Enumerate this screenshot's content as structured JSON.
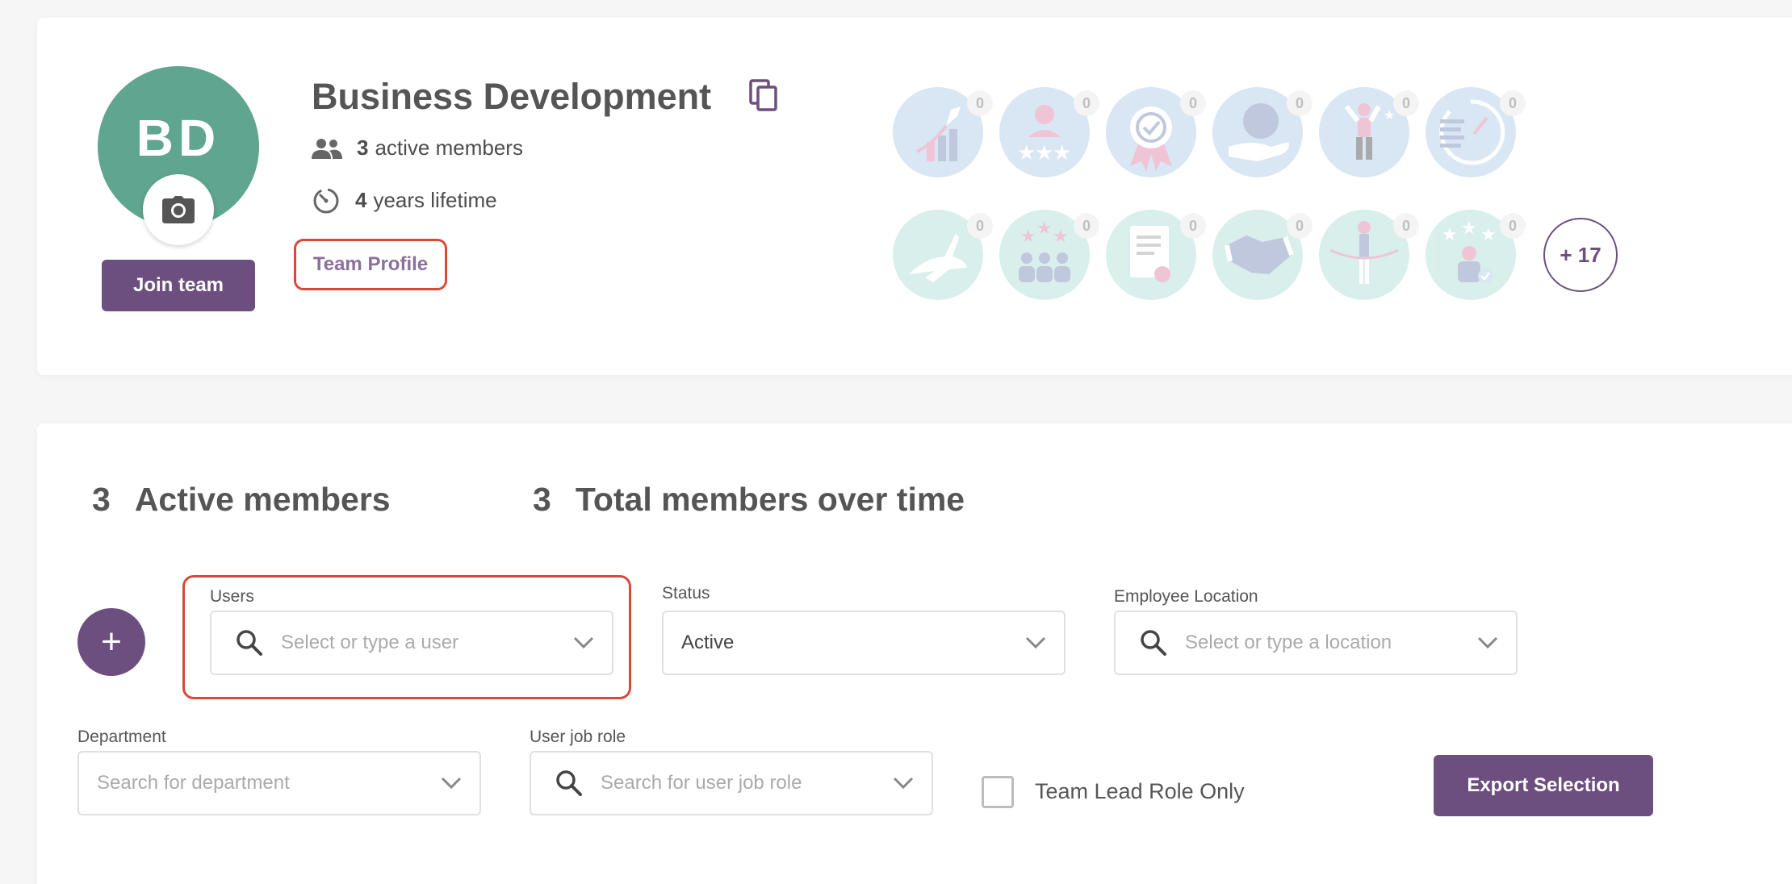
{
  "team": {
    "initials": "BD",
    "name": "Business Development",
    "active_members_count": "3",
    "active_members_text": "active members",
    "lifetime_count": "4",
    "lifetime_text": "years lifetime",
    "team_profile_link": "Team Profile",
    "join_button": "Join team"
  },
  "badges": {
    "row1": [
      {
        "icon": "rocket-growth-icon",
        "count": "0"
      },
      {
        "icon": "star-rating-person-icon",
        "count": "0"
      },
      {
        "icon": "award-ribbon-icon",
        "count": "0"
      },
      {
        "icon": "globe-hand-icon",
        "count": "0"
      },
      {
        "icon": "celebrating-person-icon",
        "count": "0"
      },
      {
        "icon": "stopwatch-icon",
        "count": "0"
      }
    ],
    "row2": [
      {
        "icon": "running-rabbit-icon",
        "count": "0"
      },
      {
        "icon": "star-team-icon",
        "count": "0"
      },
      {
        "icon": "certificate-icon",
        "count": "0"
      },
      {
        "icon": "handshake-icon",
        "count": "0"
      },
      {
        "icon": "finish-line-icon",
        "count": "0"
      },
      {
        "icon": "rated-employee-icon",
        "count": "0"
      }
    ],
    "more": "+ 17"
  },
  "stats": {
    "active_count": "3",
    "active_label": "Active members",
    "total_count": "3",
    "total_label": "Total members over time"
  },
  "filters": {
    "add_button": "+",
    "users": {
      "label": "Users",
      "placeholder": "Select or type a user"
    },
    "status": {
      "label": "Status",
      "value": "Active"
    },
    "location": {
      "label": "Employee Location",
      "placeholder": "Select or type a location"
    },
    "department": {
      "label": "Department",
      "placeholder": "Search for department"
    },
    "job_role": {
      "label": "User job role",
      "placeholder": "Search for user job role"
    },
    "team_lead_only": "Team Lead Role Only",
    "export_button": "Export Selection"
  },
  "colors": {
    "brand_purple": "#6c4f7f",
    "avatar_green": "#5fa58f",
    "highlight_red": "#d64a3a",
    "badge_blue": "#c3d7ee",
    "badge_teal": "#c1e6df"
  }
}
